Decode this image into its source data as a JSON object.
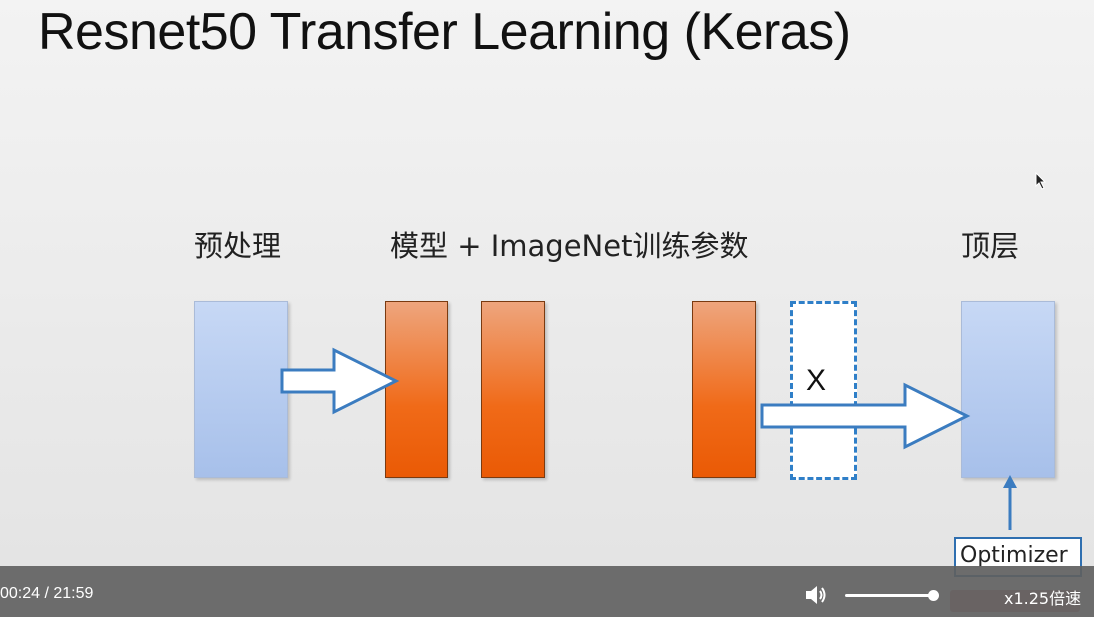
{
  "slide": {
    "title": "Resnet50 Transfer Learning (Keras)",
    "labels": {
      "preprocess": "预处理",
      "model": "模型 + ImageNet训练参数",
      "top_layer": "顶层"
    },
    "dropped_layer_mark": "X",
    "optimizer": "Optimizer"
  },
  "player": {
    "time_display": "00:24 / 21:59",
    "volume_level": 1.0,
    "speed_label": "x1.25倍速"
  },
  "colors": {
    "control_bar": "#5f5f5f",
    "arrow_stroke": "#3b7cc0",
    "orange": "#f06a18",
    "blue": "#a7c0ea"
  }
}
